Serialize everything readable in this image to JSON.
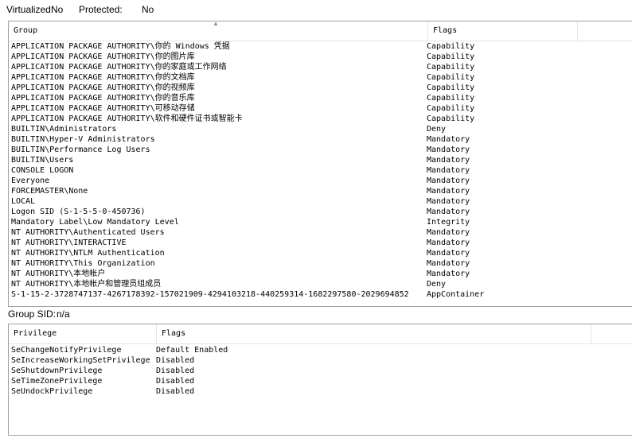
{
  "header": {
    "virtualized_label": "Virtualized:",
    "virtualized_value": "No",
    "protected_label": "Protected:",
    "protected_value": "No"
  },
  "groups_table": {
    "columns": [
      "Group",
      "Flags"
    ],
    "rows": [
      {
        "group": "APPLICATION PACKAGE AUTHORITY\\你的 Windows 凭据",
        "flags": "Capability"
      },
      {
        "group": "APPLICATION PACKAGE AUTHORITY\\你的图片库",
        "flags": "Capability"
      },
      {
        "group": "APPLICATION PACKAGE AUTHORITY\\你的家庭或工作网络",
        "flags": "Capability"
      },
      {
        "group": "APPLICATION PACKAGE AUTHORITY\\你的文档库",
        "flags": "Capability"
      },
      {
        "group": "APPLICATION PACKAGE AUTHORITY\\你的视频库",
        "flags": "Capability"
      },
      {
        "group": "APPLICATION PACKAGE AUTHORITY\\你的音乐库",
        "flags": "Capability"
      },
      {
        "group": "APPLICATION PACKAGE AUTHORITY\\可移动存储",
        "flags": "Capability"
      },
      {
        "group": "APPLICATION PACKAGE AUTHORITY\\软件和硬件证书或智能卡",
        "flags": "Capability"
      },
      {
        "group": "BUILTIN\\Administrators",
        "flags": "Deny"
      },
      {
        "group": "BUILTIN\\Hyper-V Administrators",
        "flags": "Mandatory"
      },
      {
        "group": "BUILTIN\\Performance Log Users",
        "flags": "Mandatory"
      },
      {
        "group": "BUILTIN\\Users",
        "flags": "Mandatory"
      },
      {
        "group": "CONSOLE LOGON",
        "flags": "Mandatory"
      },
      {
        "group": "Everyone",
        "flags": "Mandatory"
      },
      {
        "group": "FORCEMASTER\\None",
        "flags": "Mandatory"
      },
      {
        "group": "LOCAL",
        "flags": "Mandatory"
      },
      {
        "group": "Logon SID (S-1-5-5-0-450736)",
        "flags": "Mandatory"
      },
      {
        "group": "Mandatory Label\\Low Mandatory Level",
        "flags": "Integrity"
      },
      {
        "group": "NT AUTHORITY\\Authenticated Users",
        "flags": "Mandatory"
      },
      {
        "group": "NT AUTHORITY\\INTERACTIVE",
        "flags": "Mandatory"
      },
      {
        "group": "NT AUTHORITY\\NTLM Authentication",
        "flags": "Mandatory"
      },
      {
        "group": "NT AUTHORITY\\This Organization",
        "flags": "Mandatory"
      },
      {
        "group": "NT AUTHORITY\\本地帐户",
        "flags": "Mandatory"
      },
      {
        "group": "NT AUTHORITY\\本地帐户和管理员组成员",
        "flags": "Deny"
      },
      {
        "group": "S-1-15-2-3728747137-4267178392-157021909-4294103218-440259314-1682297580-2029694852",
        "flags": "AppContainer"
      }
    ]
  },
  "group_sid": {
    "label": "Group SID:",
    "value": "n/a"
  },
  "privileges_table": {
    "columns": [
      "Privilege",
      "Flags"
    ],
    "rows": [
      {
        "privilege": "SeChangeNotifyPrivilege",
        "flags": "Default Enabled"
      },
      {
        "privilege": "SeIncreaseWorkingSetPrivilege",
        "flags": "Disabled"
      },
      {
        "privilege": "SeShutdownPrivilege",
        "flags": "Disabled"
      },
      {
        "privilege": "SeTimeZonePrivilege",
        "flags": "Disabled"
      },
      {
        "privilege": "SeUndockPrivilege",
        "flags": "Disabled"
      }
    ]
  },
  "icons": {
    "sort_indicator": "sort-ascending-icon"
  }
}
